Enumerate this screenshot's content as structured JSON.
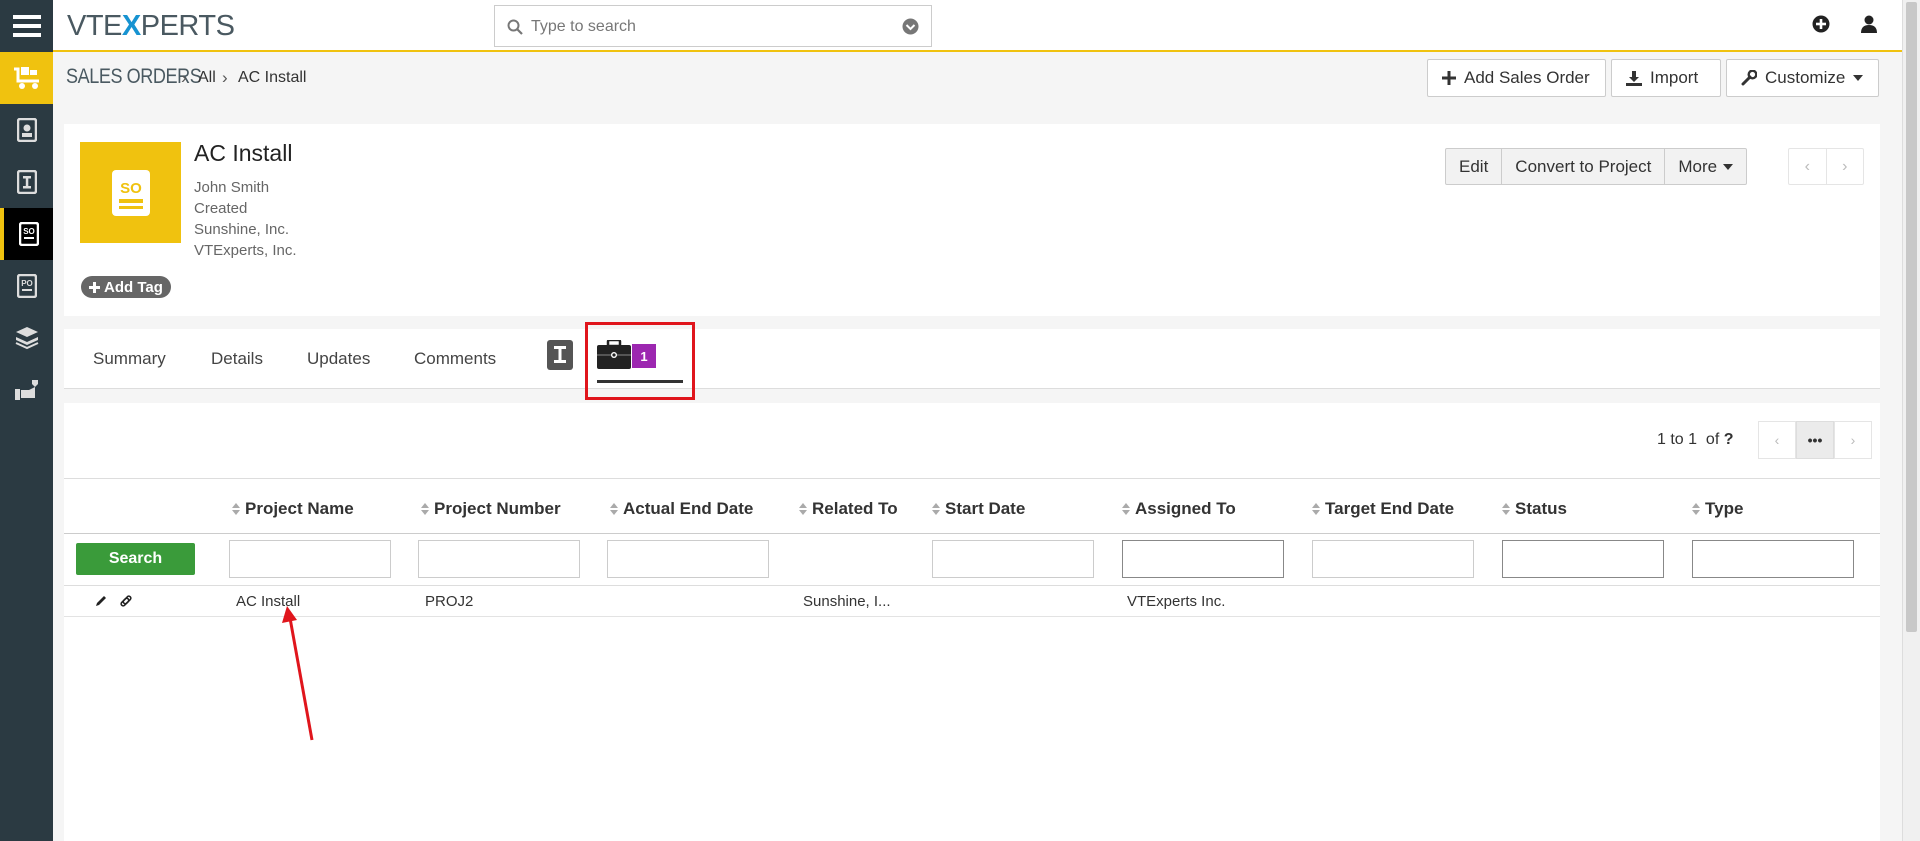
{
  "app": {
    "logo_left": "VTE",
    "logo_x": "X",
    "logo_right": "PERTS",
    "accent": "#f0c20f"
  },
  "search": {
    "placeholder": "Type to search"
  },
  "breadcrumb": {
    "module": "SALES ORDERS",
    "filter": "All",
    "record": "AC Install"
  },
  "header_actions": {
    "add": "Add Sales Order",
    "import": "Import",
    "customize": "Customize"
  },
  "record": {
    "icon_text": "SO",
    "title": "AC Install",
    "lines": [
      "John Smith",
      "Created",
      "Sunshine, Inc.",
      "VTExperts, Inc."
    ],
    "add_tag": "Add Tag",
    "actions": {
      "edit": "Edit",
      "convert": "Convert to Project",
      "more": "More"
    }
  },
  "tabs": {
    "summary": "Summary",
    "details": "Details",
    "updates": "Updates",
    "comments": "Comments",
    "projects_count": "1"
  },
  "related": {
    "pager_range": "1 to 1",
    "pager_of": "of",
    "pager_total": "?",
    "pager_more": "•••",
    "search_button": "Search",
    "columns": [
      "Project Name",
      "Project Number",
      "Actual End Date",
      "Related To",
      "Start Date",
      "Assigned To",
      "Target End Date",
      "Status",
      "Type"
    ],
    "rows": [
      {
        "project_name": "AC Install",
        "project_number": "PROJ2",
        "actual_end_date": "",
        "related_to": "Sunshine, I...",
        "start_date": "",
        "assigned_to": "VTExperts Inc.",
        "target_end_date": "",
        "status": "",
        "type": ""
      }
    ]
  },
  "annotation_color": "#e0151c"
}
